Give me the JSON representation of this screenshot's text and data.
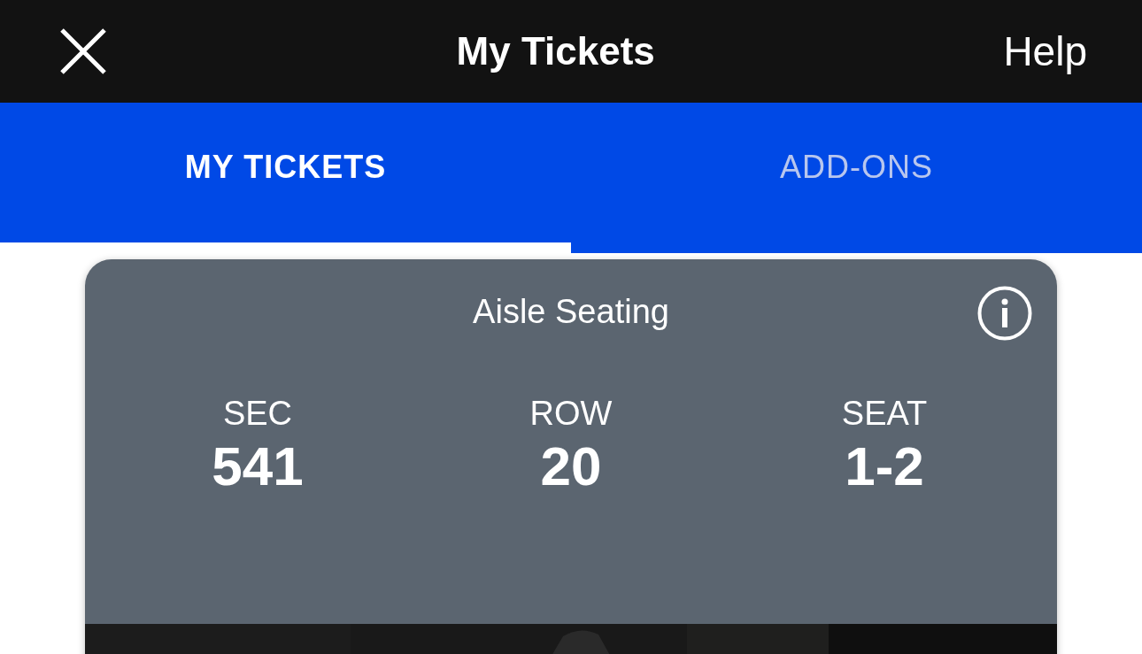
{
  "top_bar": {
    "title": "My Tickets",
    "help": "Help"
  },
  "tabs": [
    {
      "label": "MY TICKETS",
      "selected": true
    },
    {
      "label": "ADD-ONS",
      "selected": false
    }
  ],
  "ticket": {
    "title": "Aisle Seating",
    "details": [
      {
        "label": "SEC",
        "value": "541"
      },
      {
        "label": "ROW",
        "value": "20"
      },
      {
        "label": "SEAT",
        "value": "1-2"
      }
    ]
  }
}
